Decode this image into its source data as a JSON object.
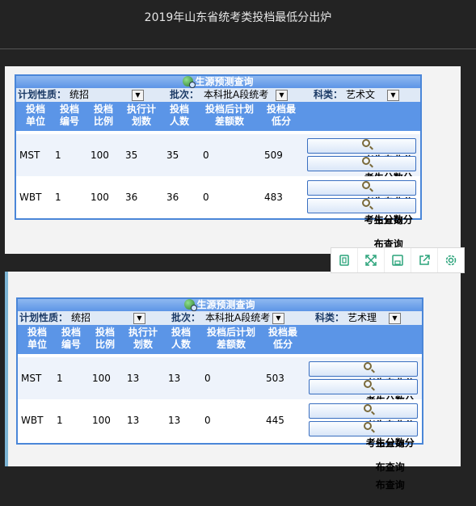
{
  "page_title": "2019年山东省统考类投档最低分出炉",
  "panels": [
    {
      "title": "生源预测查询",
      "filters": {
        "plan_label": "计划性质：",
        "plan_value": "统招",
        "batch_label": "批次：",
        "batch_value": "本科批A段统考",
        "subject_label": "科类：",
        "subject_value": "艺术文"
      },
      "headers": [
        "投档\n单位",
        "投档\n编号",
        "投档\n比例",
        "执行计\n划数",
        "投档\n人数",
        "投档后计划\n差额数",
        "投档最\n低分"
      ],
      "rows": [
        {
          "unit": "MST",
          "code": "1",
          "ratio": "100",
          "plan": "35",
          "count": "35",
          "diff": "0",
          "min": "509"
        },
        {
          "unit": "WBT",
          "code": "1",
          "ratio": "100",
          "plan": "36",
          "count": "36",
          "diff": "0",
          "min": "483"
        }
      ],
      "btn_major": "考生专业分布查询",
      "btn_score": "考生分数分布查询"
    },
    {
      "title": "生源预测查询",
      "filters": {
        "plan_label": "计划性质：",
        "plan_value": "统招",
        "batch_label": "批次：",
        "batch_value": "本科批A段统考",
        "subject_label": "科类：",
        "subject_value": "艺术理"
      },
      "headers": [
        "投档\n单位",
        "投档\n编号",
        "投档\n比例",
        "执行计\n划数",
        "投档\n人数",
        "投档后计划\n差额数",
        "投档最\n低分"
      ],
      "rows": [
        {
          "unit": "MST",
          "code": "1",
          "ratio": "100",
          "plan": "13",
          "count": "13",
          "diff": "0",
          "min": "503"
        },
        {
          "unit": "WBT",
          "code": "1",
          "ratio": "100",
          "plan": "13",
          "count": "13",
          "diff": "0",
          "min": "445"
        }
      ],
      "btn_major": "考生专业分布查询",
      "btn_score": "考生分数分布查询"
    }
  ],
  "toolbar": [
    "bookmark-icon",
    "fullscreen-icon",
    "save-icon",
    "share-icon",
    "settings-icon"
  ],
  "colors": {
    "header_blue": "#5b95e7",
    "border_blue": "#4a86d8",
    "toolbar_green": "#2aa37a"
  }
}
